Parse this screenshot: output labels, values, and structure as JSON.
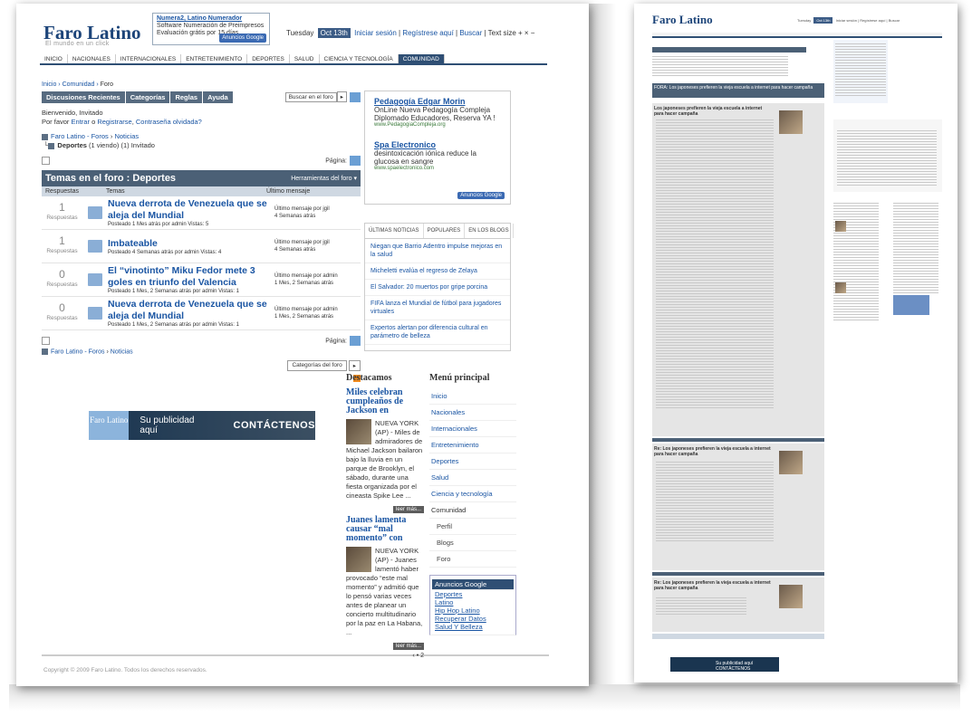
{
  "header": {
    "logo": "Faro Latino",
    "tagline": "El mundo en un click",
    "ad_title": "Numera2, Latino Numerador",
    "ad_line1": "Software Numeración de Preimpresos",
    "ad_line2": "Evaluación grátis por 15 días",
    "ad_badge": "Anuncios Google",
    "day": "Tuesday",
    "date": "Oct 13th",
    "login": "Iniciar sesión",
    "register": "Regístrese aquí",
    "search": "Buscar",
    "textsize": "Text size",
    "textsize_ctrls": "+ × −"
  },
  "nav": [
    "INICIO",
    "NACIONALES",
    "INTERNACIONALES",
    "ENTRETENIMIENTO",
    "DEPORTES",
    "SALUD",
    "CIENCIA Y TECNOLOGÍA",
    "COMUNIDAD"
  ],
  "breadcrumb": {
    "a": "Inicio",
    "b": "Comunidad",
    "c": "Foro"
  },
  "forum": {
    "tabs": [
      "Discusiones Recientes",
      "Categorías",
      "Reglas",
      "Ayuda"
    ],
    "search_btn": "Buscar en el foro",
    "welcome_title": "Bienvenido, Invitado",
    "welcome_please": "Por favor",
    "enter": "Entrar",
    "or": "o",
    "register": "Registrarse",
    "forgot": "Contraseña olvidada?",
    "path_a": "Faro Latino - Foros",
    "path_b": "Noticias",
    "sub": "Deportes",
    "sub_meta": "(1 viendo) (1) Invitado",
    "page_label": "Página:",
    "section_title": "Temas en el foro : Deportes",
    "tools": "Herramientas del foro",
    "col_replies": "Respuestas",
    "col_topics": "Temas",
    "col_last": "Último mensaje",
    "replies_word": "Respuestas",
    "topics": [
      {
        "count": "1",
        "title": "Nueva derrota de Venezuela que se aleja del Mundial",
        "meta": "Posteado 1 Mes atrás por admin Vistas: 5",
        "last1": "Último mensaje por jgil",
        "last2": "4 Semanas atrás"
      },
      {
        "count": "1",
        "title": "Imbateable",
        "meta": "Posteado 4 Semanas atrás por admin Vistas: 4",
        "last1": "Último mensaje por jgil",
        "last2": "4 Semanas atrás"
      },
      {
        "count": "0",
        "title": "El “vinotinto” Miku Fedor mete 3 goles en triunfo del Valencia",
        "meta": "Posteado 1 Mes, 2 Semanas atrás por admin Vistas: 1",
        "last1": "Último mensaje por admin",
        "last2": "1 Mes, 2 Semanas atrás"
      },
      {
        "count": "0",
        "title": "Nueva derrota de Venezuela que se aleja del Mundial",
        "meta": "Posteado 1 Mes, 2 Semanas atrás por admin Vistas: 1",
        "last1": "Último mensaje por admin",
        "last2": "1 Mes, 2 Semanas atrás"
      }
    ],
    "footpath_a": "Faro Latino - Foros",
    "footpath_b": "Noticias",
    "cat_select": "Categorías del foro"
  },
  "banner": {
    "logo": "Faro Latino",
    "text1": "Su publicidad aquí",
    "text2": "CONTÁCTENOS"
  },
  "copyright": "Copyright © 2009 Faro Latino. Todos los derechos reservados.",
  "ads": [
    {
      "title": "Pedagogía Edgar Morin",
      "desc": "OnLine Nueva Pedagogía Compleja Diplomado Educadores, Reserva YA !",
      "url": "www.PedagogiaCompleja.org"
    },
    {
      "title": "Spa Electronico",
      "desc": "desintoxicación iónica reduce la glucosa en sangre",
      "url": "www.spaelectronico.com"
    }
  ],
  "ads_badge": "Anuncios Google",
  "news": {
    "tabs": [
      "ÚLTIMAS NOTICIAS",
      "POPULARES",
      "EN LOS BLOGS"
    ],
    "items": [
      "Niegan que Barrio Adentro impulse mejoras en la salud",
      "Micheletti evalúa el regreso de Zelaya",
      "El Salvador: 20 muertos por gripe porcina",
      "FIFA lanza el Mundial de fútbol para jugadores virtuales",
      "Expertos alertan por diferencia cultural en parámetro de belleza"
    ]
  },
  "destacamos": {
    "heading": "Destacamos",
    "a_title": "Miles celebran cumpleaños de Jackson en",
    "a_text": "NUEVA YORK (AP) - Miles de admiradores de Michael Jackson bailaron bajo la lluvia en un parque de Brooklyn, el sábado, durante una fiesta organizada por el cineasta Spike Lee ...",
    "more": "leer más...",
    "b_title": "Juanes lamenta causar “mal momento” con",
    "b_text": "NUEVA YORK (AP) - Juanes lamentó haber provocado “este mal momento” y admitió que lo pensó varias veces antes de planear un concierto multitudinario por la paz en La Habana, ...",
    "pager": "‹ • 2"
  },
  "menu": {
    "heading": "Menú principal",
    "items": [
      "Inicio",
      "Nacionales",
      "Internacionales",
      "Entretenimiento",
      "Deportes",
      "Salud",
      "Ciencia y tecnología"
    ],
    "community": "Comunidad",
    "sub": [
      "Perfil",
      "Blogs",
      "Foro"
    ],
    "adlinks_head": "Anuncios Google",
    "adlinks": [
      "Deportes",
      "Latino",
      "Hip Hop Latino",
      "Recuperar Datos",
      "Salud Y Belleza"
    ]
  },
  "page2": {
    "logo": "Faro Latino",
    "topic_title": "FORA: Los japoneses prefieren la vieja escuela a internet para hacer campaña",
    "post1": "Los japoneses prefieren la vieja escuela a internet para hacer campaña",
    "reply1": "Re: Los japoneses prefieren la vieja escuela a internet para hacer campaña",
    "reply2": "Re: Los japoneses prefieren la vieja escuela a internet para hacer campaña",
    "banner": "Su publicidad aquí CONTÁCTENOS"
  }
}
